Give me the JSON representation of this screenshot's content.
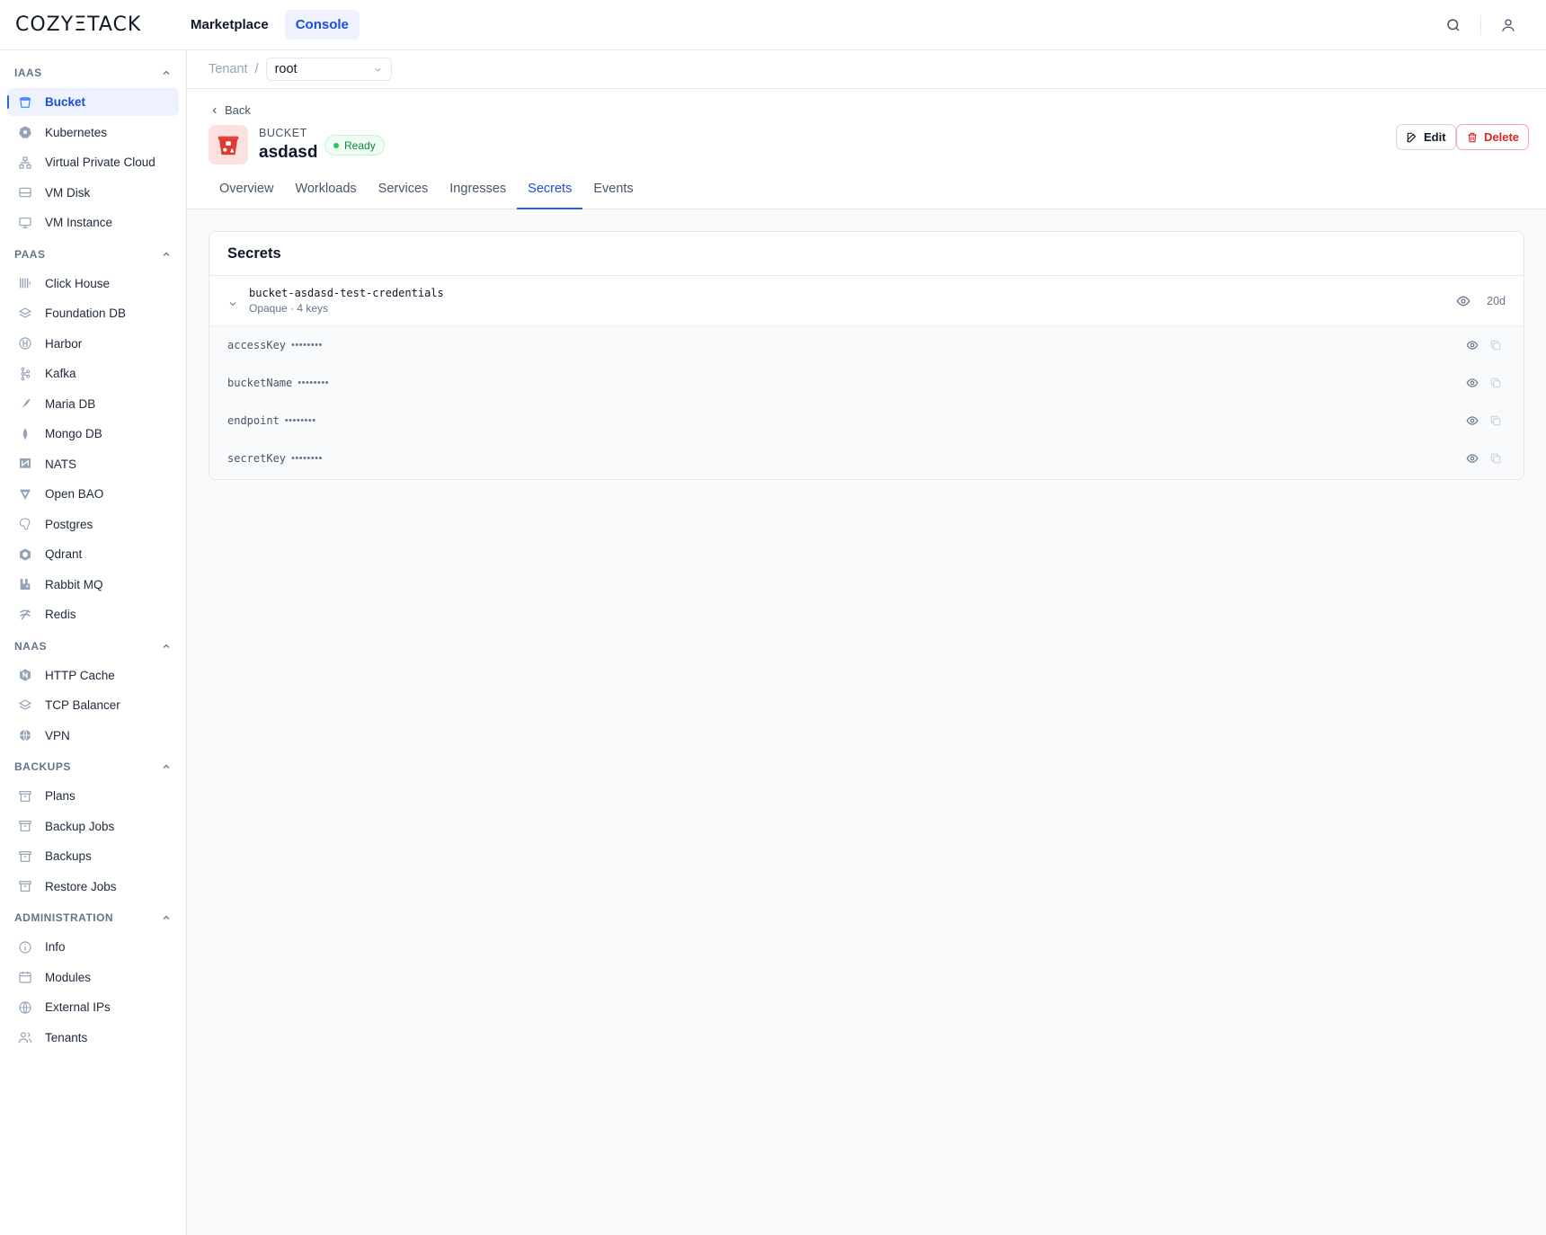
{
  "topbar": {
    "logo": "COZYΞTACK",
    "nav": [
      {
        "label": "Marketplace",
        "active": false
      },
      {
        "label": "Console",
        "active": true
      }
    ]
  },
  "sidebar": {
    "sections": [
      {
        "title": "IAAS",
        "items": [
          {
            "label": "Bucket",
            "icon": "bucket-icon",
            "active": true
          },
          {
            "label": "Kubernetes",
            "icon": "kubernetes-icon"
          },
          {
            "label": "Virtual Private Cloud",
            "icon": "network-icon"
          },
          {
            "label": "VM Disk",
            "icon": "disk-icon"
          },
          {
            "label": "VM Instance",
            "icon": "monitor-icon"
          }
        ]
      },
      {
        "title": "PAAS",
        "items": [
          {
            "label": "Click House",
            "icon": "clickhouse-icon"
          },
          {
            "label": "Foundation DB",
            "icon": "layers-icon"
          },
          {
            "label": "Harbor",
            "icon": "harbor-icon"
          },
          {
            "label": "Kafka",
            "icon": "kafka-icon"
          },
          {
            "label": "Maria DB",
            "icon": "mariadb-icon"
          },
          {
            "label": "Mongo DB",
            "icon": "mongodb-icon"
          },
          {
            "label": "NATS",
            "icon": "nats-icon"
          },
          {
            "label": "Open BAO",
            "icon": "openbao-icon"
          },
          {
            "label": "Postgres",
            "icon": "postgres-icon"
          },
          {
            "label": "Qdrant",
            "icon": "qdrant-icon"
          },
          {
            "label": "Rabbit MQ",
            "icon": "rabbitmq-icon"
          },
          {
            "label": "Redis",
            "icon": "redis-icon"
          }
        ]
      },
      {
        "title": "NAAS",
        "items": [
          {
            "label": "HTTP Cache",
            "icon": "nginx-icon"
          },
          {
            "label": "TCP Balancer",
            "icon": "layers-icon"
          },
          {
            "label": "VPN",
            "icon": "vpn-icon"
          }
        ]
      },
      {
        "title": "BACKUPS",
        "items": [
          {
            "label": "Plans",
            "icon": "archive-icon"
          },
          {
            "label": "Backup Jobs",
            "icon": "archive-icon"
          },
          {
            "label": "Backups",
            "icon": "archive-icon"
          },
          {
            "label": "Restore Jobs",
            "icon": "archive-icon"
          }
        ]
      },
      {
        "title": "ADMINISTRATION",
        "items": [
          {
            "label": "Info",
            "icon": "info-icon"
          },
          {
            "label": "Modules",
            "icon": "calendar-icon"
          },
          {
            "label": "External IPs",
            "icon": "globe-icon"
          },
          {
            "label": "Tenants",
            "icon": "users-icon"
          }
        ]
      }
    ]
  },
  "breadcrumb": {
    "tenant_label": "Tenant",
    "separator": "/",
    "selected": "root"
  },
  "header": {
    "back_label": "Back",
    "kind": "BUCKET",
    "name": "asdasd",
    "status": "Ready",
    "edit_label": "Edit",
    "delete_label": "Delete",
    "tabs": [
      {
        "label": "Overview"
      },
      {
        "label": "Workloads"
      },
      {
        "label": "Services"
      },
      {
        "label": "Ingresses"
      },
      {
        "label": "Secrets",
        "active": true
      },
      {
        "label": "Events"
      }
    ]
  },
  "secrets": {
    "title": "Secrets",
    "secret": {
      "name": "bucket-asdasd-test-credentials",
      "meta": "Opaque · 4 keys",
      "age": "20d"
    },
    "keys": [
      {
        "name": "accessKey",
        "value": "••••••••"
      },
      {
        "name": "bucketName",
        "value": "••••••••"
      },
      {
        "name": "endpoint",
        "value": "••••••••"
      },
      {
        "name": "secretKey",
        "value": "••••••••"
      }
    ]
  },
  "colors": {
    "accent": "#2563eb",
    "danger": "#dc2626",
    "success": "#22c55e"
  }
}
